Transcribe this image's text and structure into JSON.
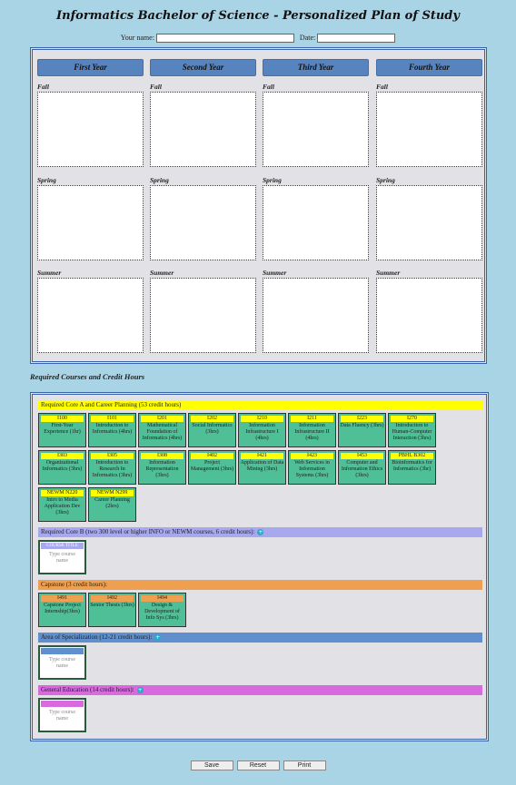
{
  "header": {
    "title": "Informatics Bachelor of Science - Personalized Plan of Study",
    "name_label": "Your name:",
    "date_label": "Date:",
    "name_value": "",
    "date_value": ""
  },
  "plan": {
    "years": [
      "First Year",
      "Second Year",
      "Third Year",
      "Fourth Year"
    ],
    "terms": [
      "Fall",
      "Spring",
      "Summer"
    ]
  },
  "required": {
    "title": "Required Courses and Credit Hours",
    "core_a": {
      "label": "Required Core A and Career Planning (53 credit hours)",
      "color": "#ffff00",
      "courses": [
        {
          "code": "I100",
          "name": "First-Year Experience (1hr)"
        },
        {
          "code": "I101",
          "name": "Introduction to Informatics (4hrs)"
        },
        {
          "code": "I201",
          "name": "Mathematical Foundation of Informatics (4hrs)"
        },
        {
          "code": "I202",
          "name": "Social Informatics (3hrs)"
        },
        {
          "code": "I210",
          "name": "Information Infrastructure I (4hrs)"
        },
        {
          "code": "I211",
          "name": "Information Infrastructure II (4hrs)"
        },
        {
          "code": "I223",
          "name": "Data Fluency (3hrs)"
        },
        {
          "code": "I270",
          "name": "Introduction to Human-Computer Interaction (3hrs)"
        },
        {
          "code": "I303",
          "name": "Organizational Informatics (3hrs)"
        },
        {
          "code": "I305",
          "name": "Introduction to Research In Informatics (3hrs)"
        },
        {
          "code": "I308",
          "name": "Information Representation (3hrs)"
        },
        {
          "code": "I402",
          "name": "Project Management (3hrs)"
        },
        {
          "code": "I421",
          "name": "Application of Data Mining (3hrs)"
        },
        {
          "code": "I423",
          "name": "Web Services in Information Systems (3hrs)"
        },
        {
          "code": "I453",
          "name": "Computer and Information Ethics (3hrs)"
        },
        {
          "code": "PBHL B302",
          "name": "Bioinformatics for Informatics (3hr)"
        },
        {
          "code": "NEWM N220",
          "name": "Intro to Media Application Dev (3hrs)"
        },
        {
          "code": "NEWM N299",
          "name": "Career Planning (2hrs)"
        }
      ]
    },
    "core_b": {
      "label": "Required Core B (two 300 level or higher INFO or NEWM courses, 6 credit hours):",
      "color": "#a8a8ee",
      "slot_header": "COURSE TITLE",
      "placeholder": "Type course name"
    },
    "capstone": {
      "label": "Capstone (3 credit hours):",
      "color": "#eea050",
      "courses": [
        {
          "code": "I491",
          "name": "Capstone Project Internship(3hrs)"
        },
        {
          "code": "I492",
          "name": "Senior Thesis (3hrs)"
        },
        {
          "code": "I494",
          "name": "Design & Development of Info Sys (3hrs)"
        }
      ]
    },
    "specialization": {
      "label": "Area of Specialization (12-21 credit hours):",
      "color": "#5f8fcc",
      "placeholder": "Type course name"
    },
    "gen_ed": {
      "label": "General Education (14 credit hours):",
      "color": "#d86ae0",
      "placeholder": "Type course name"
    }
  },
  "buttons": {
    "save": "Save",
    "reset": "Reset",
    "print": "Print"
  }
}
